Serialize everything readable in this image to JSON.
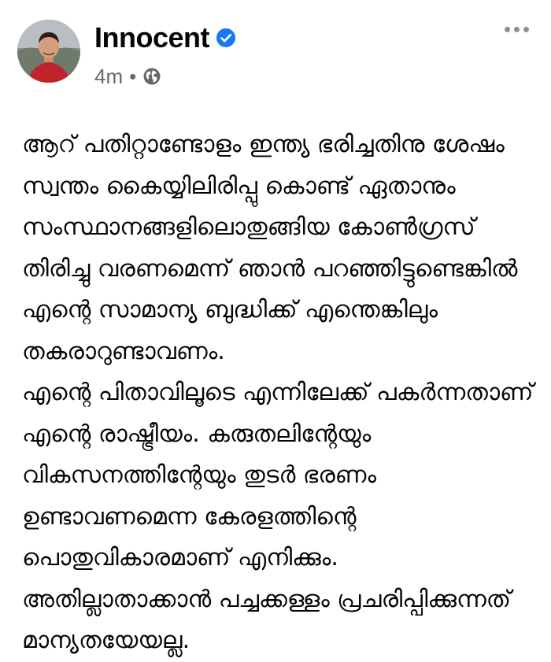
{
  "post": {
    "author": {
      "name": "Innocent",
      "avatar_icon": "profile-photo",
      "verified_icon": "verified-badge-icon",
      "verified_color": "#1877f2"
    },
    "meta": {
      "time": "4m",
      "separator": "•",
      "audience_icon": "globe-icon"
    },
    "more_icon": "more-options-icon",
    "lines": [
      "ആറ് പതിറ്റാണ്ടോളം ഇന്ത്യ ഭരിച്ചതിനു ശേഷം",
      "സ്വന്തം കൈയ്യിലിരിപ്പു കൊണ്ട് ഏതാനും",
      "സംസ്ഥാനങ്ങളിലൊതുങ്ങിയ കോൺഗ്രസ്",
      "തിരിച്ചു വരണമെന്ന് ഞാൻ പറഞ്ഞിട്ടുണ്ടെങ്കിൽ",
      "എന്റെ സാമാന്യ ബുദ്ധിക്ക് എന്തെങ്കിലും",
      "തകരാറുണ്ടാവണം.",
      "എന്റെ പിതാവിലൂടെ എന്നിലേക്ക് പകർന്നതാണ്",
      "എന്റെ രാഷ്ട്രീയം. കരുതലിന്റേയും",
      "വികസനത്തിന്റേയും തുടർ ഭരണം",
      "ഉണ്ടാവണമെന്ന കേരളത്തിന്റെ",
      "പൊതുവികാരമാണ് എനിക്കും.",
      "അതില്ലാതാക്കാൻ പച്ചക്കള്ളം പ്രചരിപ്പിക്കുന്നത്",
      "മാന്യതയേയല്ല."
    ]
  }
}
